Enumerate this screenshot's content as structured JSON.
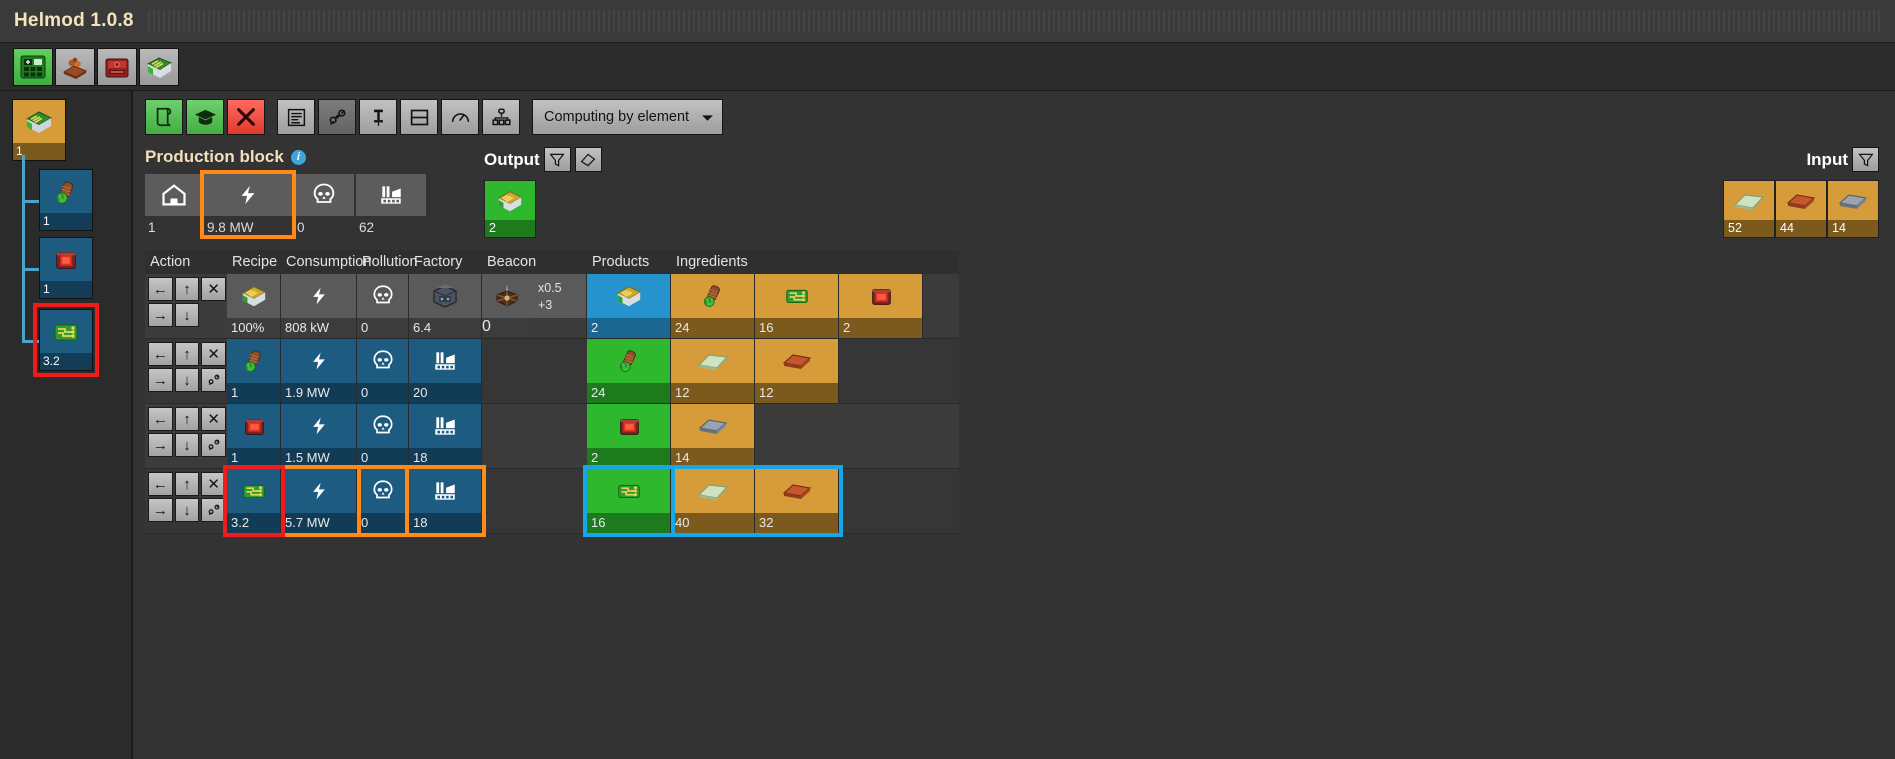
{
  "window": {
    "title": "Helmod 1.0.8"
  },
  "tabs": [
    {
      "name": "tab-production-line",
      "icon": "calculator-plus-icon",
      "active": true
    },
    {
      "name": "tab-resources",
      "icon": "copper-ore-plate-icon",
      "active": false
    },
    {
      "name": "tab-red-chest",
      "icon": "red-chest-icon",
      "active": false
    },
    {
      "name": "tab-green-circuit",
      "icon": "green-circuit-icon",
      "active": false
    }
  ],
  "sidebar": {
    "root": {
      "label": "1",
      "icon": "electronic-circuit-icon",
      "selected": false
    },
    "children": [
      {
        "label": "1",
        "icon": "copper-cable-icon",
        "selected": false
      },
      {
        "label": "1",
        "icon": "red-chest-icon",
        "selected": false
      },
      {
        "label": "3.2",
        "icon": "circuit-board-icon",
        "selected": true
      }
    ]
  },
  "toolbar": {
    "buttons": [
      {
        "name": "recipe-list-button",
        "icon": "scroll-icon",
        "style": "green"
      },
      {
        "name": "technology-button",
        "icon": "graduation-icon",
        "style": "green"
      },
      {
        "name": "remove-button",
        "icon": "cross-icon",
        "style": "red"
      },
      {
        "name": "summary-button",
        "icon": "list-icon",
        "style": "plain"
      },
      {
        "name": "link-button",
        "icon": "unlink-icon",
        "style": "dark"
      },
      {
        "name": "pin-button",
        "icon": "pin-icon",
        "style": "plain"
      },
      {
        "name": "split-view-button",
        "icon": "split-rows-icon",
        "style": "plain"
      },
      {
        "name": "speed-button",
        "icon": "gauge-icon",
        "style": "plain"
      },
      {
        "name": "matrix-button",
        "icon": "hierarchy-icon",
        "style": "plain"
      }
    ],
    "solver_dropdown": {
      "value": "Computing by element",
      "caret": "chevron-down-icon"
    }
  },
  "production_block": {
    "title": "Production block",
    "info_glyph": "i",
    "summary": [
      {
        "name": "building-count",
        "icon": "factory-house-icon",
        "value": "1",
        "highlight": false
      },
      {
        "name": "energy-usage",
        "icon": "bolt-icon",
        "value": "9.8 MW",
        "highlight": true
      },
      {
        "name": "pollution",
        "icon": "skull-icon",
        "value": "0",
        "highlight": true
      },
      {
        "name": "machine-count",
        "icon": "factory-icon",
        "value": "62",
        "highlight": true
      }
    ]
  },
  "output_panel": {
    "title": "Output",
    "buttons": [
      {
        "name": "filter-button",
        "icon": "funnel-icon"
      },
      {
        "name": "erase-button",
        "icon": "eraser-icon"
      }
    ],
    "items": [
      {
        "name": "output-item-electronic-circuit",
        "icon": "electronic-circuit-icon",
        "value": "2",
        "color": "green"
      }
    ]
  },
  "input_panel": {
    "title": "Input",
    "buttons": [
      {
        "name": "filter-button",
        "icon": "funnel-icon"
      }
    ],
    "items": [
      {
        "name": "input-item-glass-plate",
        "icon": "glass-plate-icon",
        "value": "52",
        "color": "gold"
      },
      {
        "name": "input-item-copper-plate",
        "icon": "copper-plate-icon",
        "value": "44",
        "color": "gold"
      },
      {
        "name": "input-item-iron-plate",
        "icon": "iron-plate-icon",
        "value": "14",
        "color": "gold"
      }
    ]
  },
  "recipe_table": {
    "headers": [
      "Action",
      "Recipe",
      "Consumption",
      "Pollution",
      "Factory",
      "Beacon",
      "Products",
      "Ingredients"
    ],
    "rows": [
      {
        "name": "row-electronic-circuit",
        "actions_top": [
          "left-arrow-icon",
          "up-arrow-icon",
          "close-icon"
        ],
        "actions_bottom": [
          "right-arrow-icon",
          "down-arrow-icon",
          ""
        ],
        "recipe": {
          "icon": "electronic-circuit-icon",
          "value": "100%",
          "color": "grey"
        },
        "consumption": {
          "icon": "bolt-icon",
          "value": "808 kW",
          "color": "grey"
        },
        "pollution": {
          "icon": "skull-icon",
          "value": "0",
          "color": "grey"
        },
        "factory": {
          "icon": "assembling-machine-icon",
          "value": "6.4",
          "color": "grey"
        },
        "beacon": {
          "icon": "beacon-icon",
          "value": "0",
          "multiplier": "x0.5",
          "extra": "+3",
          "color": "grey"
        },
        "products": [
          {
            "icon": "electronic-circuit-icon",
            "value": "2",
            "color": "cyan"
          }
        ],
        "ingredients": [
          {
            "icon": "copper-cable-icon",
            "value": "24",
            "color": "gold"
          },
          {
            "icon": "circuit-board-icon",
            "value": "16",
            "color": "gold"
          },
          {
            "icon": "red-chest-icon",
            "value": "2",
            "color": "gold"
          }
        ]
      },
      {
        "name": "row-copper-cable",
        "actions_top": [
          "left-arrow-icon",
          "up-arrow-icon",
          "close-icon"
        ],
        "actions_bottom": [
          "right-arrow-icon",
          "down-arrow-icon",
          "unlink-icon"
        ],
        "recipe": {
          "icon": "copper-cable-icon",
          "value": "1",
          "color": "blue"
        },
        "consumption": {
          "icon": "bolt-icon",
          "value": "1.9 MW",
          "color": "blue"
        },
        "pollution": {
          "icon": "skull-icon",
          "value": "0",
          "color": "blue"
        },
        "factory": {
          "icon": "factory-icon",
          "value": "20",
          "color": "blue"
        },
        "beacon": null,
        "products": [
          {
            "icon": "copper-cable-icon",
            "value": "24",
            "color": "green"
          }
        ],
        "ingredients": [
          {
            "icon": "glass-plate-icon",
            "value": "12",
            "color": "gold"
          },
          {
            "icon": "copper-plate-icon",
            "value": "12",
            "color": "gold"
          }
        ]
      },
      {
        "name": "row-red-chest",
        "actions_top": [
          "left-arrow-icon",
          "up-arrow-icon",
          "close-icon"
        ],
        "actions_bottom": [
          "right-arrow-icon",
          "down-arrow-icon",
          "unlink-icon"
        ],
        "recipe": {
          "icon": "red-chest-icon",
          "value": "1",
          "color": "blue"
        },
        "consumption": {
          "icon": "bolt-icon",
          "value": "1.5 MW",
          "color": "blue"
        },
        "pollution": {
          "icon": "skull-icon",
          "value": "0",
          "color": "blue"
        },
        "factory": {
          "icon": "factory-icon",
          "value": "18",
          "color": "blue"
        },
        "beacon": null,
        "products": [
          {
            "icon": "red-chest-icon",
            "value": "2",
            "color": "green"
          }
        ],
        "ingredients": [
          {
            "icon": "iron-plate-icon",
            "value": "14",
            "color": "gold"
          }
        ]
      },
      {
        "name": "row-circuit-board",
        "selected": true,
        "actions_top": [
          "left-arrow-icon",
          "up-arrow-icon",
          "close-icon"
        ],
        "actions_bottom": [
          "right-arrow-icon",
          "down-arrow-icon",
          "unlink-icon"
        ],
        "recipe": {
          "icon": "circuit-board-icon",
          "value": "3.2",
          "color": "blue"
        },
        "consumption": {
          "icon": "bolt-icon",
          "value": "5.7 MW",
          "color": "blue"
        },
        "pollution": {
          "icon": "skull-icon",
          "value": "0",
          "color": "blue"
        },
        "factory": {
          "icon": "factory-icon",
          "value": "18",
          "color": "blue"
        },
        "beacon": null,
        "products": [
          {
            "icon": "circuit-board-icon",
            "value": "16",
            "color": "green"
          }
        ],
        "ingredients": [
          {
            "icon": "glass-plate-icon",
            "value": "40",
            "color": "gold"
          },
          {
            "icon": "copper-plate-icon",
            "value": "32",
            "color": "gold"
          }
        ]
      }
    ]
  },
  "colors": {
    "accent_orange": "#ff8a17",
    "accent_red": "#f01c1c",
    "accent_cyan": "#17a7e8",
    "title_text": "#f5e3bd",
    "green_cell": "#2eb82e",
    "gold_cell": "#d79c3a",
    "blue_cell": "#1d5c80"
  }
}
